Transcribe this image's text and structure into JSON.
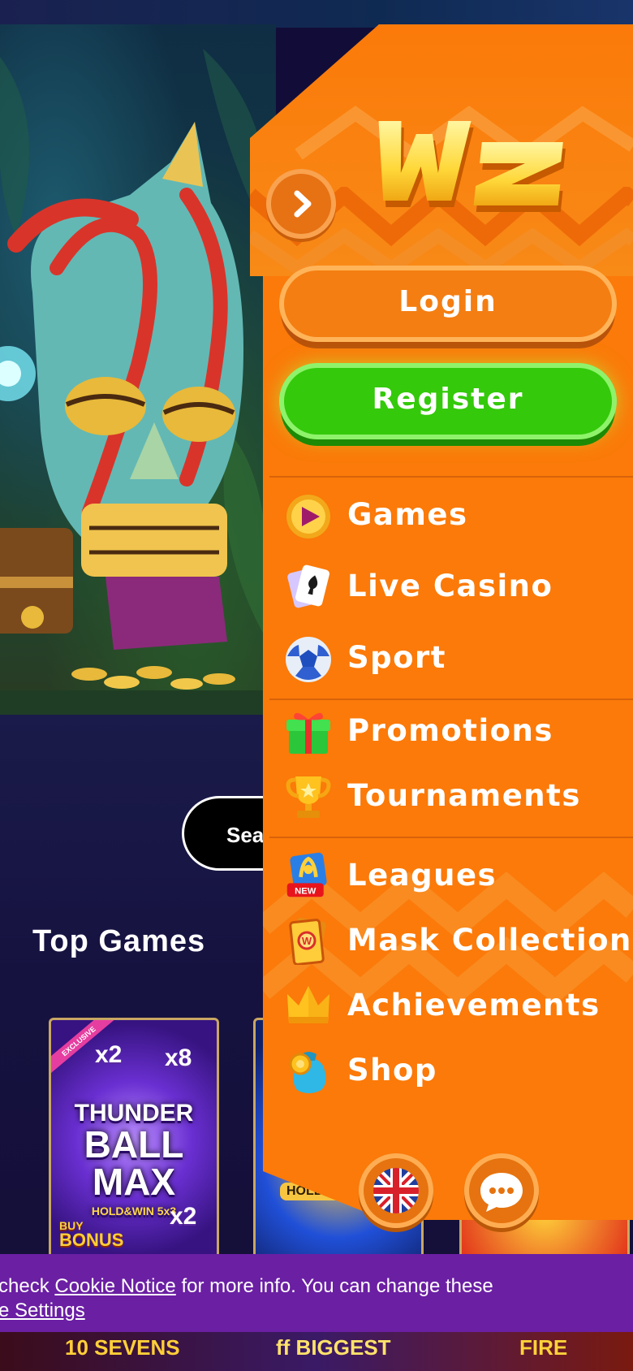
{
  "hero": {},
  "search": {
    "label": "Sea"
  },
  "sections": {
    "top_games_title": "Top Games"
  },
  "game_tiles": [
    {
      "badge": "EXCLUSIVE",
      "mult_a": "x2",
      "mult_b": "x8",
      "mult_c": "x2",
      "line1": "THUNDER",
      "line2": "BALL",
      "line3": "MAX",
      "line4": "HOLD&WIN 5x3",
      "bonus_a": "BUY",
      "bonus_b": "BONUS"
    },
    {
      "label": "HOLD AN"
    },
    {}
  ],
  "bottom_strip": {
    "left": "10 SEVENS",
    "mid": "ff BIGGEST",
    "right": "FIRE"
  },
  "cookie": {
    "line1_prefix": "check ",
    "link_notice": "Cookie Notice",
    "line1_suffix": " for more info. You can change these",
    "link_settings": "e Settings"
  },
  "menu": {
    "logo_text": "Wz",
    "login_label": "Login",
    "register_label": "Register",
    "items": [
      {
        "label": "Games",
        "icon": "play-icon"
      },
      {
        "label": "Live Casino",
        "icon": "cards-icon"
      },
      {
        "label": "Sport",
        "icon": "soccer-ball-icon"
      },
      {
        "label": "Promotions",
        "icon": "gift-icon"
      },
      {
        "label": "Tournaments",
        "icon": "trophy-icon"
      },
      {
        "label": "Leagues",
        "icon": "leagues-icon",
        "badge": "NEW"
      },
      {
        "label": "Mask Collection",
        "icon": "mask-card-icon"
      },
      {
        "label": "Achievements",
        "icon": "crown-icon"
      },
      {
        "label": "Shop",
        "icon": "coin-bag-icon"
      }
    ],
    "language_icon": "uk-flag-icon",
    "chat_icon": "chat-icon"
  },
  "colors": {
    "menu_orange": "#fb7a09",
    "register_green": "#34c90b",
    "cookie_purple": "#6b1fa3",
    "page_bg": "#120d38"
  }
}
